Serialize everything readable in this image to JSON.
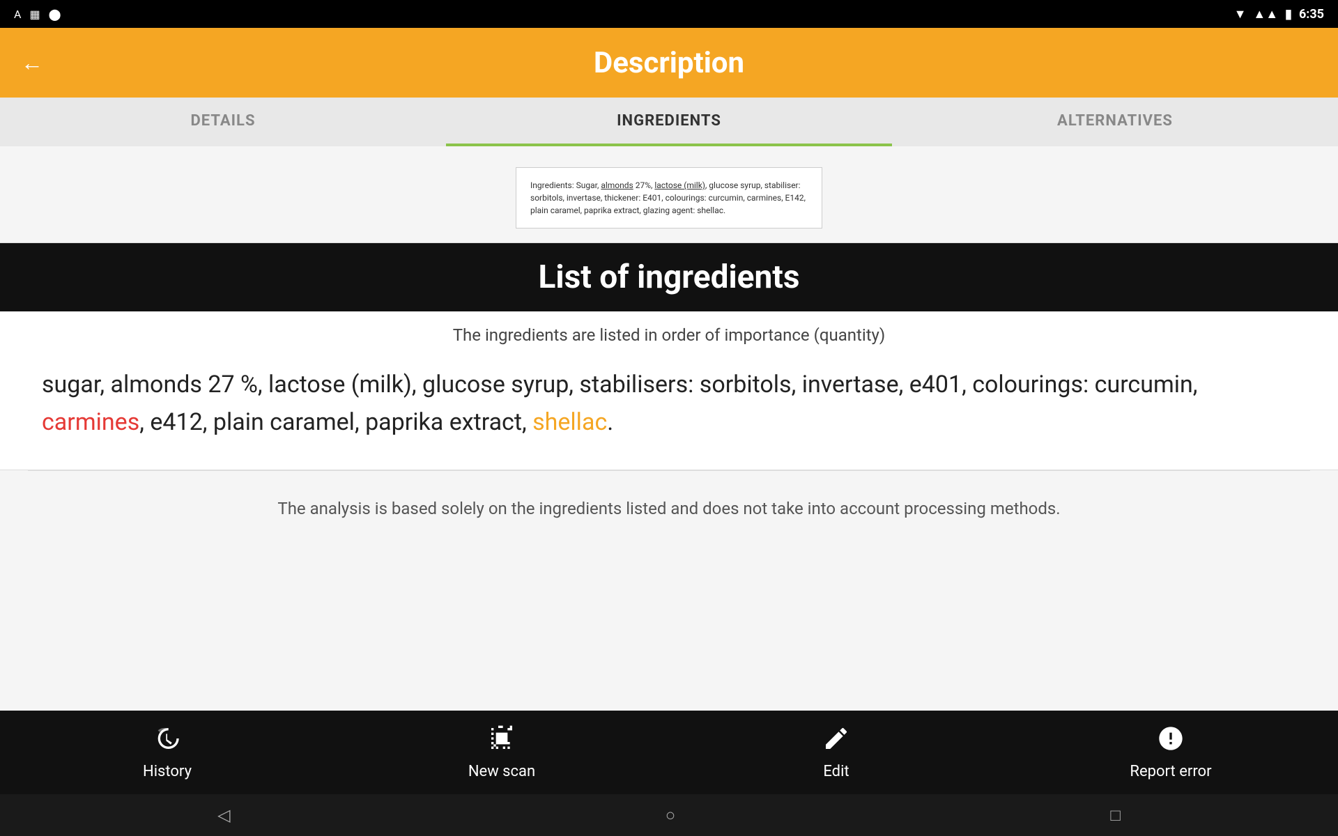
{
  "statusBar": {
    "time": "6:35",
    "icons": [
      "A",
      "sim",
      "circle"
    ]
  },
  "appBar": {
    "title": "Description",
    "backLabel": "←"
  },
  "tabs": [
    {
      "id": "details",
      "label": "DETAILS",
      "active": false
    },
    {
      "id": "ingredients",
      "label": "INGREDIENTS",
      "active": true
    },
    {
      "id": "alternatives",
      "label": "ALTERNATIVES",
      "active": false
    }
  ],
  "ingredientsImage": {
    "text": "Ingredients: Sugar, almonds 27%, lactose (milk), glucose syrup, stabiliser: sorbitols, invertase, thickener: E401, colourings: curcumin, carmines, E142, plain caramel, paprika extract, glazing agent: shellac."
  },
  "ingredientsSection": {
    "headerTitle": "List of ingredients",
    "subtitle": "The ingredients are listed in order of importance (quantity)",
    "textParts": [
      {
        "text": "sugar, almonds 27 %, lactose (milk), glucose syrup, stabilisers: sorbitols, invertase, e401, colourings: curcumin, ",
        "type": "normal"
      },
      {
        "text": "carmines",
        "type": "red"
      },
      {
        "text": ", e412, plain caramel, paprika extract, ",
        "type": "normal"
      },
      {
        "text": "shellac",
        "type": "orange"
      },
      {
        "text": ".",
        "type": "normal"
      }
    ]
  },
  "analysisNote": {
    "text": "The analysis is based solely on the ingredients listed and does not take into account processing methods."
  },
  "bottomNav": {
    "items": [
      {
        "id": "history",
        "label": "History",
        "icon": "history"
      },
      {
        "id": "new-scan",
        "label": "New scan",
        "icon": "scanner"
      },
      {
        "id": "edit",
        "label": "Edit",
        "icon": "edit"
      },
      {
        "id": "report-error",
        "label": "Report error",
        "icon": "exclamation"
      }
    ]
  },
  "systemNav": {
    "back": "◁",
    "home": "○",
    "recent": "□"
  }
}
